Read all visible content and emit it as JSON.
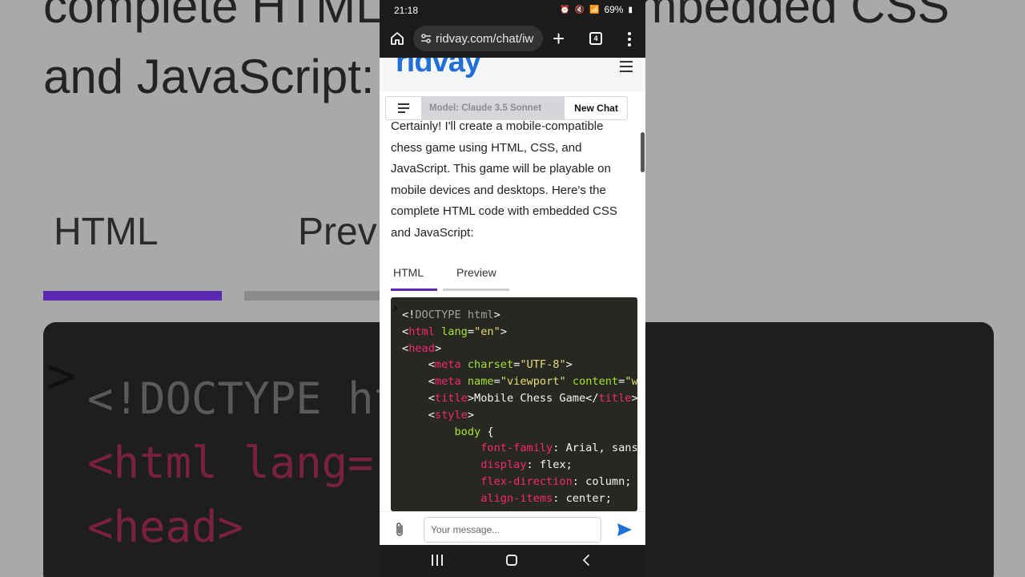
{
  "background": {
    "line_1": "complete HTML code with embedded CSS",
    "line_2": "and JavaScript:",
    "tab_html": "HTML",
    "tab_preview": "Preview",
    "code_1": "<!DOCTYPE ht",
    "code_2": "<html lang=\"",
    "code_3": "<head>"
  },
  "status_bar": {
    "time": "21:18",
    "battery": "69%"
  },
  "browser": {
    "url": "ridvay.com/chat/iw",
    "tab_count": "4"
  },
  "site": {
    "logo": "ridvay"
  },
  "toolbar": {
    "model_label": "Model: Claude 3.5 Sonnet",
    "new_chat_label": "New Chat"
  },
  "message": {
    "text": "Certainly! I'll create a mobile-compatible chess game using HTML, CSS, and JavaScript. This game will be playable on mobile devices and desktops. Here's the complete HTML code with embedded CSS and JavaScript:"
  },
  "tabs": {
    "html_label": "HTML",
    "preview_label": "Preview"
  },
  "code": {
    "l1_doctype": "DOCTYPE html",
    "l2_tag": "html",
    "l2_attr": "lang",
    "l2_val": "\"en\"",
    "l3_tag": "head",
    "l4_tag": "meta",
    "l4_attr": "charset",
    "l4_val": "\"UTF-8\"",
    "l5_tag": "meta",
    "l5_attr1": "name",
    "l5_val1": "\"viewport\"",
    "l5_attr2": "content",
    "l5_val2": "\"w",
    "l6_tag": "title",
    "l6_text": "Mobile Chess Game",
    "l6_tag_close": "title",
    "l7_tag": "style",
    "l8_sel": "body",
    "l9_prop": "font-family",
    "l9_val": "Arial, sans",
    "l10_prop": "display",
    "l10_val": "flex;",
    "l11_prop": "flex-direction",
    "l11_val": "column;",
    "l12_prop": "align-items",
    "l12_val": "center;"
  },
  "composer": {
    "placeholder": "Your message..."
  },
  "colors": {
    "accent": "#5c2ab0",
    "brand": "#1f6fd6",
    "code_bg": "#272822"
  }
}
